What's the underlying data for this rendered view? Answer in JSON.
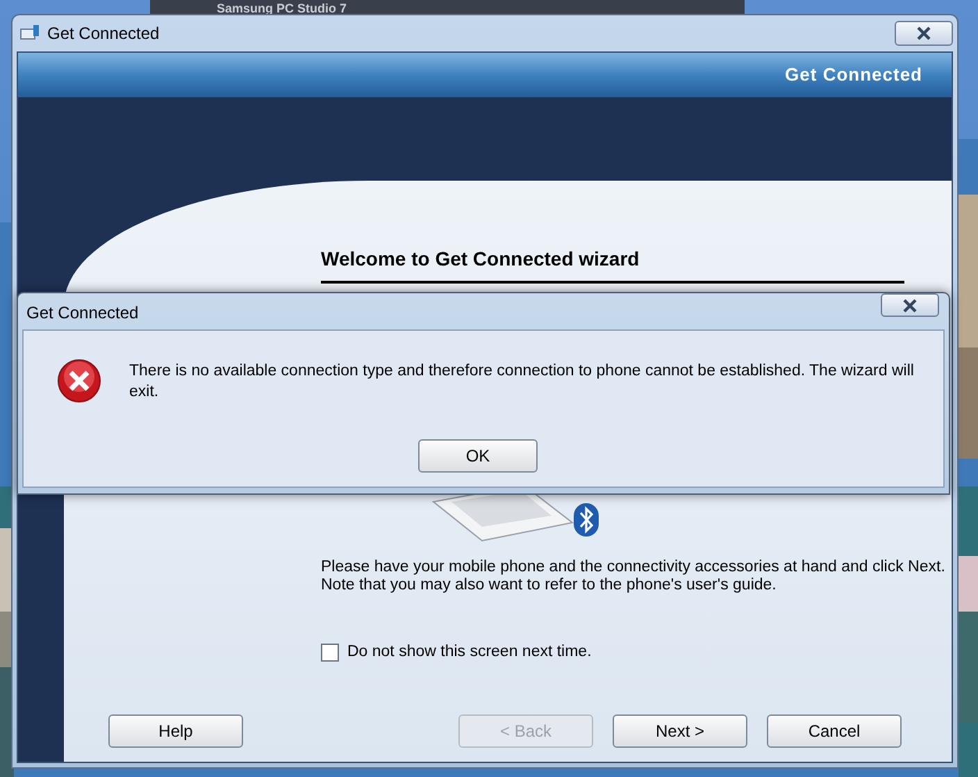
{
  "background_window": {
    "title": "Samsung PC Studio 7"
  },
  "window": {
    "title": "Get Connected",
    "header": "Get Connected",
    "heading": "Welcome to Get Connected wizard",
    "instructions": "Please have your mobile phone and the connectivity accessories at hand and click Next.\nNote that you may also want to refer to the phone's user's guide.",
    "checkbox": {
      "label": "Do not show this screen next time.",
      "checked": false
    },
    "buttons": [
      {
        "label": "Help",
        "disabled": false
      },
      {
        "label": "< Back",
        "disabled": true
      },
      {
        "label": "Next >",
        "disabled": false
      },
      {
        "label": "Cancel",
        "disabled": false
      }
    ]
  },
  "dialog": {
    "title": "Get Connected",
    "message": "There is no available connection type and therefore connection to phone cannot be established. The wizard will exit.",
    "buttons": [
      {
        "label": "OK"
      }
    ]
  }
}
